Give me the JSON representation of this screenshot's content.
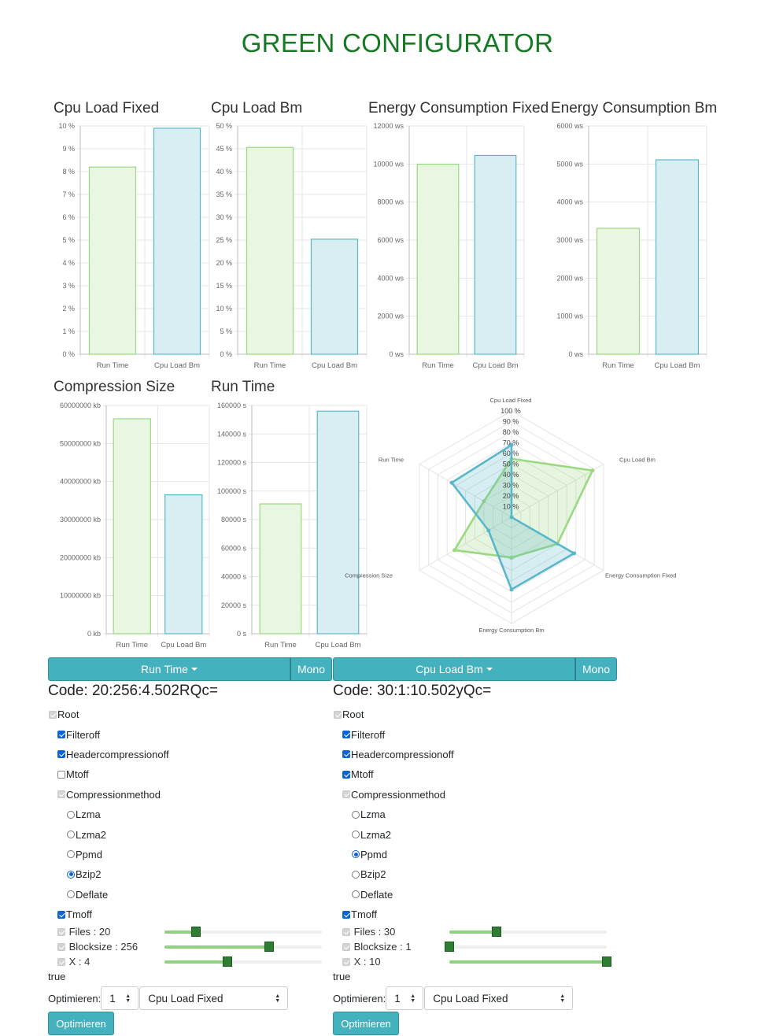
{
  "title": "GREEN CONFIGURATOR",
  "colors": {
    "green_bar": "#9ad97f",
    "green_fill": "#e8f6e2",
    "blue_bar": "#5ab7c9",
    "blue_fill": "#d8eef2",
    "title_green": "#157a22",
    "accent": "#44b2be"
  },
  "charts": {
    "cpu_fixed": {
      "title": "Cpu Load Fixed"
    },
    "cpu_bm": {
      "title": "Cpu Load Bm"
    },
    "energy_fixed": {
      "title": "Energy Consumption Fixed"
    },
    "energy_bm": {
      "title": "Energy Consumption Bm"
    },
    "compression": {
      "title": "Compression Size"
    },
    "runtime": {
      "title": "Run Time"
    }
  },
  "chart_data": [
    {
      "type": "bar",
      "title": "Cpu Load Fixed",
      "categories": [
        "Run Time",
        "Cpu Load Bm"
      ],
      "values": [
        8.2,
        9.9
      ],
      "unit": "%",
      "ylim": [
        0,
        10
      ],
      "yticks": [
        "0 %",
        "1 %",
        "2 %",
        "3 %",
        "4 %",
        "5 %",
        "6 %",
        "7 %",
        "8 %",
        "9 %",
        "10 %"
      ]
    },
    {
      "type": "bar",
      "title": "Cpu Load Bm",
      "categories": [
        "Run Time",
        "Cpu Load Bm"
      ],
      "values": [
        45.3,
        25.2
      ],
      "unit": "%",
      "ylim": [
        0,
        50
      ],
      "yticks": [
        "0 %",
        "5 %",
        "10 %",
        "15 %",
        "20 %",
        "25 %",
        "30 %",
        "35 %",
        "40 %",
        "45 %",
        "50 %"
      ]
    },
    {
      "type": "bar",
      "title": "Energy Consumption Fixed",
      "categories": [
        "Run Time",
        "Cpu Load Bm"
      ],
      "values": [
        9990,
        10450
      ],
      "unit": "ws",
      "ylim": [
        0,
        12000
      ],
      "yticks": [
        "0 ws",
        "2000 ws",
        "4000 ws",
        "6000 ws",
        "8000 ws",
        "10000 ws",
        "12000 ws"
      ]
    },
    {
      "type": "bar",
      "title": "Energy Consumption Bm",
      "categories": [
        "Run Time",
        "Cpu Load Bm"
      ],
      "values": [
        3310,
        5110
      ],
      "unit": "ws",
      "ylim": [
        0,
        6000
      ],
      "yticks": [
        "0 ws",
        "1000 ws",
        "2000 ws",
        "3000 ws",
        "4000 ws",
        "5000 ws",
        "6000 ws"
      ]
    },
    {
      "type": "bar",
      "title": "Compression Size",
      "categories": [
        "Run Time",
        "Cpu Load Bm"
      ],
      "values": [
        56500000,
        36500000
      ],
      "unit": "kb",
      "ylim": [
        0,
        60000000
      ],
      "yticks": [
        "0 kb",
        "10000000 kb",
        "20000000 kb",
        "30000000 kb",
        "40000000 kb",
        "50000000 kb",
        "60000000 kb"
      ]
    },
    {
      "type": "bar",
      "title": "Run Time",
      "categories": [
        "Run Time",
        "Cpu Load Bm"
      ],
      "values": [
        91000,
        156000
      ],
      "unit": "s",
      "ylim": [
        0,
        160000
      ],
      "yticks": [
        "0 s",
        "20000 s",
        "40000 s",
        "60000 s",
        "80000 s",
        "100000 s",
        "120000 s",
        "140000 s",
        "160000 s"
      ]
    },
    {
      "type": "radar",
      "axes": [
        "Cpu Load Fixed",
        "Cpu Load Bm",
        "Energy Consumption Fixed",
        "Energy Consumption Bm",
        "Compression Size",
        "Run Time"
      ],
      "ticks": [
        "10 %",
        "20 %",
        "30 %",
        "40 %",
        "50 %",
        "60 %",
        "70 %",
        "80 %",
        "90 %",
        "100 %"
      ],
      "ylim": [
        0,
        100
      ],
      "series": [
        {
          "values": [
            55,
            88,
            50,
            38,
            62,
            30
          ]
        },
        {
          "values": [
            68,
            0,
            68,
            68,
            25,
            65
          ]
        }
      ]
    }
  ],
  "panels": [
    {
      "metric_label": "Run Time",
      "mono_label": "Mono",
      "code": "Code: 20:256:4.502RQc=",
      "tree": [
        {
          "kind": "cb",
          "label": "Root",
          "state": "disabled",
          "indent": 0
        },
        {
          "kind": "cb",
          "label": "Filteroff",
          "state": "checked",
          "indent": 1
        },
        {
          "kind": "cb",
          "label": "Headercompressionoff",
          "state": "checked",
          "indent": 1
        },
        {
          "kind": "cb",
          "label": "Mtoff",
          "state": "unchecked",
          "indent": 1
        },
        {
          "kind": "cb",
          "label": "Compressionmethod",
          "state": "disabled",
          "indent": 1
        },
        {
          "kind": "rb",
          "label": "Lzma",
          "state": "unchecked",
          "indent": 2
        },
        {
          "kind": "rb",
          "label": "Lzma2",
          "state": "unchecked",
          "indent": 2
        },
        {
          "kind": "rb",
          "label": "Ppmd",
          "state": "unchecked",
          "indent": 2
        },
        {
          "kind": "rb",
          "label": "Bzip2",
          "state": "checked",
          "indent": 2
        },
        {
          "kind": "rb",
          "label": "Deflate",
          "state": "unchecked",
          "indent": 2
        },
        {
          "kind": "cb",
          "label": "Tmoff",
          "state": "checked",
          "indent": 1
        }
      ],
      "sliders": [
        {
          "label": "Files : 20",
          "fraction": 0.2
        },
        {
          "label": "Blocksize : 256",
          "fraction": 0.665
        },
        {
          "label": "X : 4",
          "fraction": 0.4
        }
      ],
      "status": "true",
      "optimize_label": "Optimieren:",
      "count_value": "1",
      "target_value": "Cpu Load Fixed",
      "button_label": "Optimieren"
    },
    {
      "metric_label": "Cpu Load Bm",
      "mono_label": "Mono",
      "code": "Code: 30:1:10.502yQc=",
      "tree": [
        {
          "kind": "cb",
          "label": "Root",
          "state": "disabled",
          "indent": 0
        },
        {
          "kind": "cb",
          "label": "Filteroff",
          "state": "checked",
          "indent": 1
        },
        {
          "kind": "cb",
          "label": "Headercompressionoff",
          "state": "checked",
          "indent": 1
        },
        {
          "kind": "cb",
          "label": "Mtoff",
          "state": "checked",
          "indent": 1
        },
        {
          "kind": "cb",
          "label": "Compressionmethod",
          "state": "disabled",
          "indent": 1
        },
        {
          "kind": "rb",
          "label": "Lzma",
          "state": "unchecked",
          "indent": 2
        },
        {
          "kind": "rb",
          "label": "Lzma2",
          "state": "unchecked",
          "indent": 2
        },
        {
          "kind": "rb",
          "label": "Ppmd",
          "state": "checked",
          "indent": 2
        },
        {
          "kind": "rb",
          "label": "Bzip2",
          "state": "unchecked",
          "indent": 2
        },
        {
          "kind": "rb",
          "label": "Deflate",
          "state": "unchecked",
          "indent": 2
        },
        {
          "kind": "cb",
          "label": "Tmoff",
          "state": "checked",
          "indent": 1
        }
      ],
      "sliders": [
        {
          "label": "Files : 30",
          "fraction": 0.3
        },
        {
          "label": "Blocksize : 1",
          "fraction": 0.0
        },
        {
          "label": "X : 10",
          "fraction": 1.0
        }
      ],
      "status": "true",
      "optimize_label": "Optimieren:",
      "count_value": "1",
      "target_value": "Cpu Load Fixed",
      "button_label": "Optimieren"
    }
  ]
}
